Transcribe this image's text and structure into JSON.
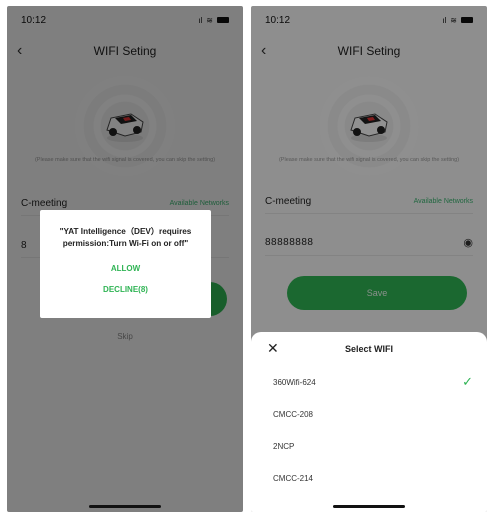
{
  "left_screen": {
    "status": {
      "time": "10:12",
      "signal": "ıl",
      "wifi": "≋"
    },
    "nav": {
      "back": "‹",
      "title": "WIFI Seting"
    },
    "hint": "(Please make sure that the wifi signal is covered, you can skip the setting)",
    "ssid": "C-meeting",
    "available": "Available Networks",
    "password_prefix": "8",
    "skip": "Skip",
    "dialog": {
      "message": "\"YAT Intelligence（DEV）requires permission:Turn Wi-Fi on or off\"",
      "allow": "ALLOW",
      "decline": "DECLINE(8)"
    }
  },
  "right_screen": {
    "status": {
      "time": "10:12",
      "signal": "ıl",
      "wifi": "≋"
    },
    "nav": {
      "back": "‹",
      "title": "WIFI Seting"
    },
    "hint": "(Please make sure that the wifi signal is covered, you can skip the setting)",
    "ssid": "C-meeting",
    "available": "Available Networks",
    "password": "88888888",
    "eye": "◉",
    "save": "Save",
    "sheet": {
      "close": "✕",
      "title": "Select WIFI",
      "items": [
        {
          "name": "360Wifi-624",
          "check": "✓"
        },
        {
          "name": "CMCC-208",
          "check": ""
        },
        {
          "name": "2NCP",
          "check": ""
        },
        {
          "name": "CMCC-214",
          "check": ""
        }
      ]
    }
  },
  "colors": {
    "accent": "#2fb454",
    "overlay": "rgba(0,0,0,0.48)"
  }
}
